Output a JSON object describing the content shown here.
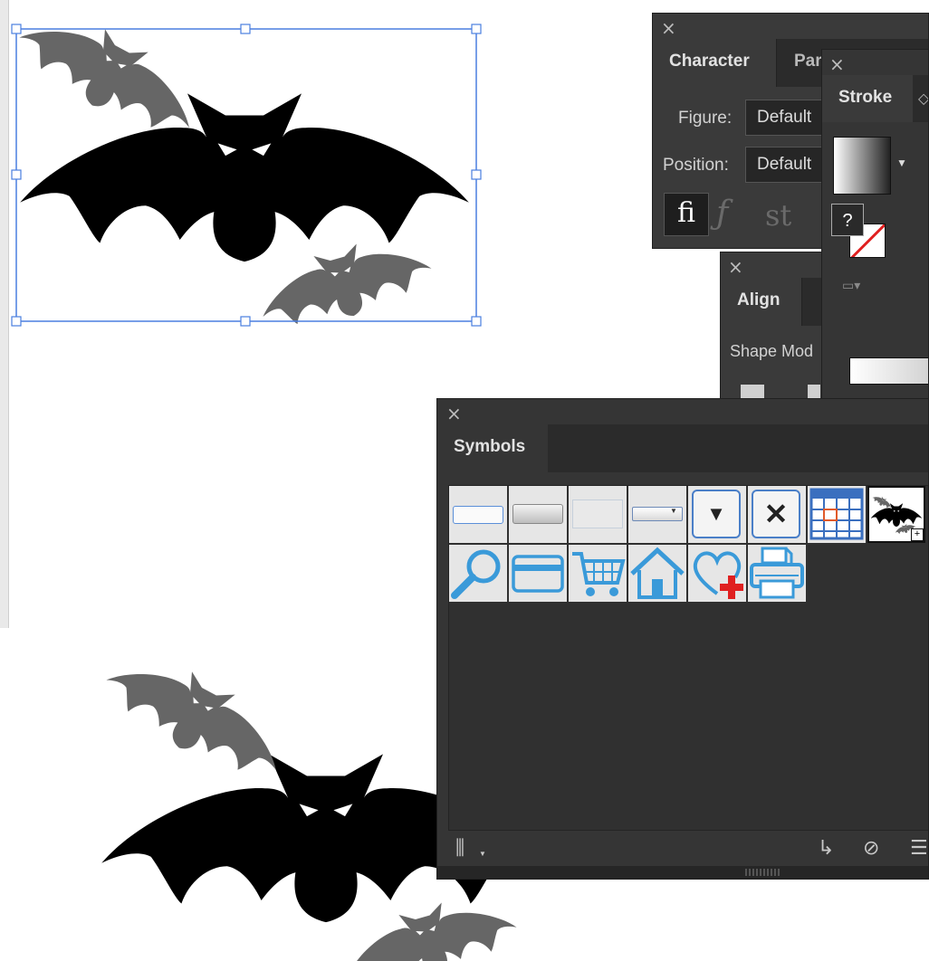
{
  "character_panel": {
    "tabs": [
      "Character",
      "Par"
    ],
    "figure_label": "Figure:",
    "figure_value": "Default",
    "position_label": "Position:",
    "position_value": "Default",
    "glyph_buttons": [
      "fi",
      "ƒ",
      "st"
    ]
  },
  "stroke_panel": {
    "tab": "Stroke",
    "unknown_badge": "?"
  },
  "align_panel": {
    "tab": "Align",
    "section_label": "Shape Mod"
  },
  "symbols_panel": {
    "tab": "Symbols",
    "symbols": [
      "button-symbol",
      "gradient-button-symbol",
      "flat-button-symbol",
      "dropdown-symbol",
      "menu-arrow-symbol",
      "close-symbol",
      "calendar-symbol",
      "bats-symbol",
      "search-symbol",
      "credit-card-symbol",
      "shopping-cart-symbol",
      "home-symbol",
      "heart-plus-symbol",
      "printer-symbol"
    ],
    "footer_icons": [
      "symbol-libraries-icon",
      "place-symbol-instance-icon",
      "break-link-icon",
      "symbol-options-icon"
    ]
  },
  "colors": {
    "panel_bg": "#3a3a3a",
    "tabbar_bg": "#2b2b2b",
    "selection": "#4a7fe0",
    "symbol_blue": "#3a9ad9",
    "bat_black": "#000000",
    "bat_gray": "#666666"
  }
}
